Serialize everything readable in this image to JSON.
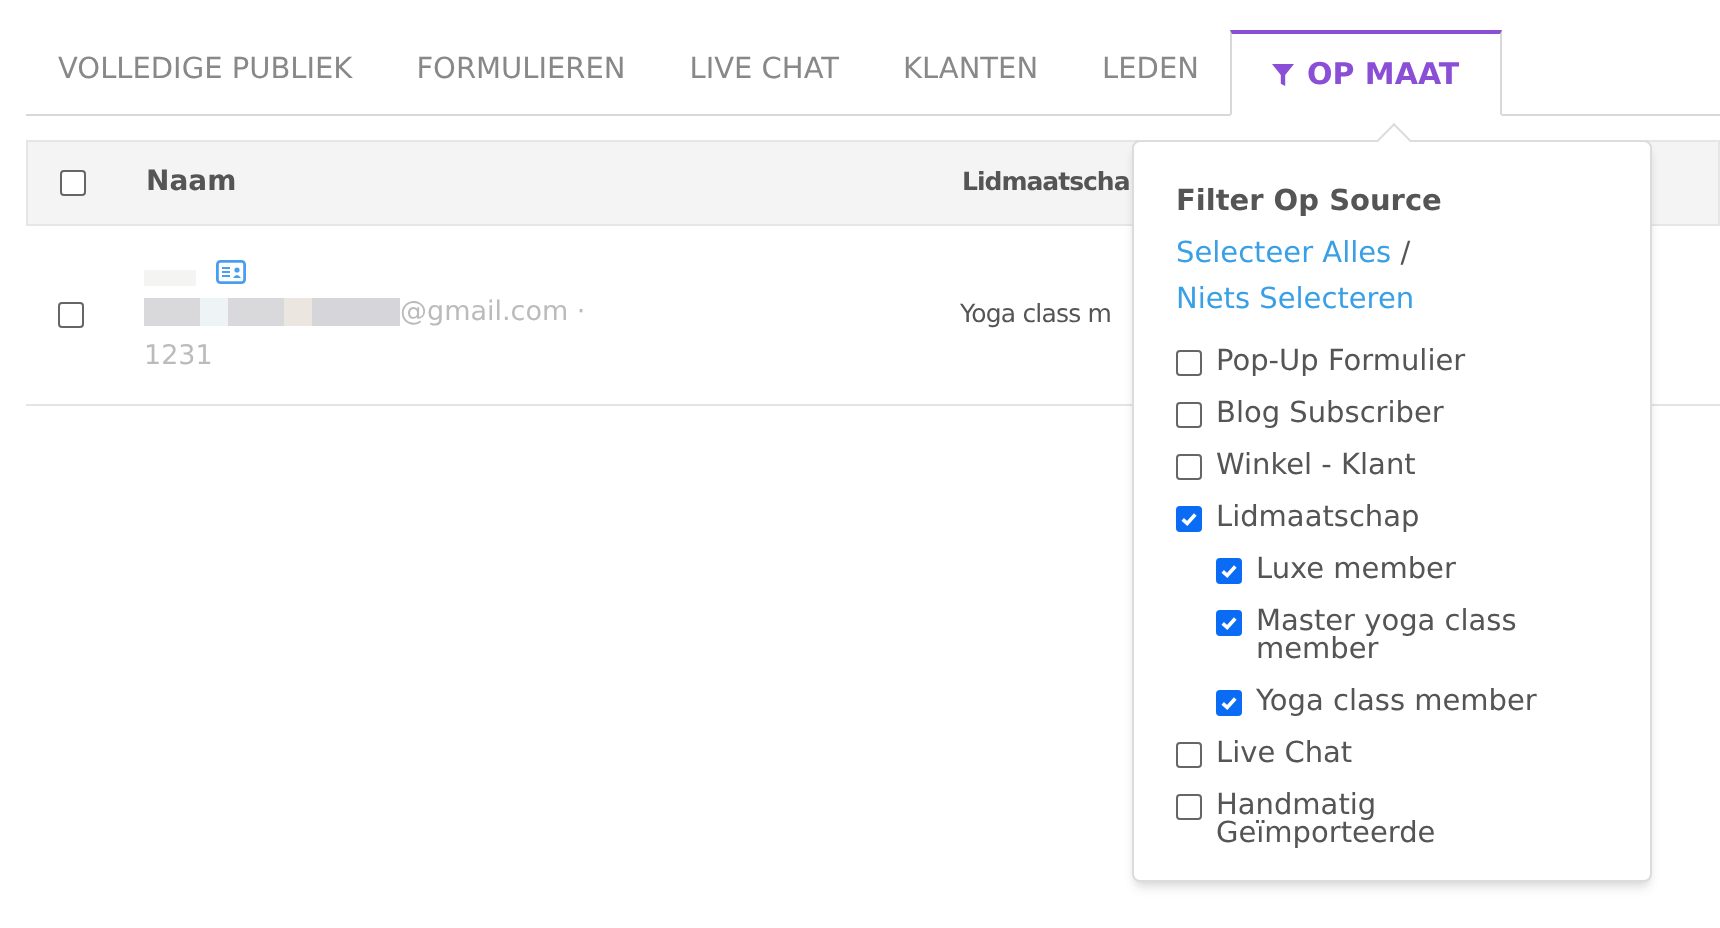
{
  "tabs": [
    {
      "label": "VOLLEDIGE PUBLIEK",
      "selected": false
    },
    {
      "label": "FORMULIEREN",
      "selected": false
    },
    {
      "label": "LIVE CHAT",
      "selected": false
    },
    {
      "label": "KLANTEN",
      "selected": false
    },
    {
      "label": "LEDEN",
      "selected": false
    },
    {
      "label": "OP MAAT",
      "selected": true
    }
  ],
  "table": {
    "columns": [
      "Naam",
      "Lidmaatscha"
    ],
    "select_all_checked": false,
    "rows": [
      {
        "checked": false,
        "email": "@gmail.com ·",
        "number": "1231",
        "membership": "Yoga class m"
      }
    ]
  },
  "filter_popup": {
    "title": "Filter Op Source",
    "select_all": "Selecteer Alles",
    "separator": "/",
    "select_none": "Niets Selecteren",
    "options": [
      {
        "label": "Pop-Up Formulier",
        "checked": false
      },
      {
        "label": "Blog Subscriber",
        "checked": false
      },
      {
        "label": "Winkel - Klant",
        "checked": false
      },
      {
        "label": "Lidmaatschap",
        "checked": true,
        "children": [
          {
            "label": "Luxe member",
            "checked": true
          },
          {
            "label": "Master yoga class member",
            "checked": true
          },
          {
            "label": "Yoga class member",
            "checked": true
          }
        ]
      },
      {
        "label": "Live Chat",
        "checked": false
      },
      {
        "label": "Handmatig Geïmporteerde",
        "checked": false
      }
    ]
  }
}
